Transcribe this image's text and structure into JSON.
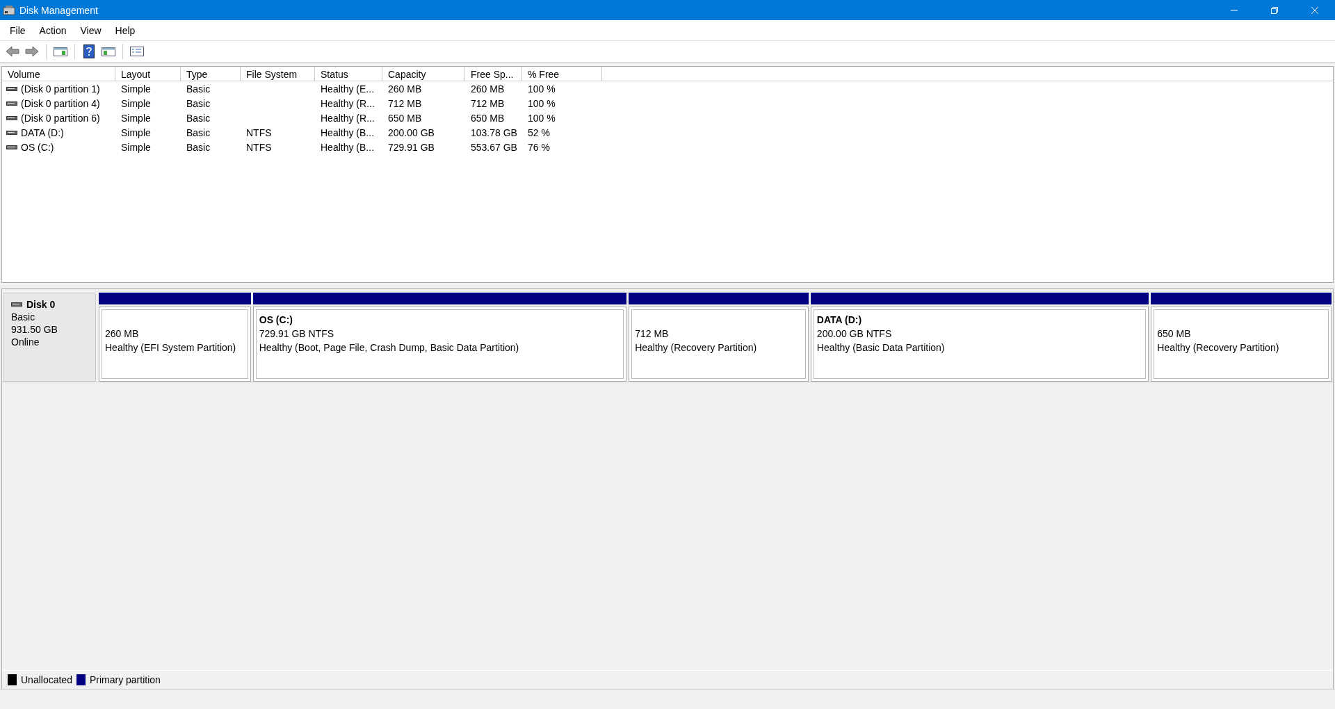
{
  "window": {
    "title": "Disk Management"
  },
  "menu": [
    "File",
    "Action",
    "View",
    "Help"
  ],
  "table": {
    "columns": [
      "Volume",
      "Layout",
      "Type",
      "File System",
      "Status",
      "Capacity",
      "Free Sp...",
      "% Free"
    ],
    "rows": [
      [
        "(Disk 0 partition 1)",
        "Simple",
        "Basic",
        "",
        "Healthy (E...",
        "260 MB",
        "260 MB",
        "100 %"
      ],
      [
        "(Disk 0 partition 4)",
        "Simple",
        "Basic",
        "",
        "Healthy (R...",
        "712 MB",
        "712 MB",
        "100 %"
      ],
      [
        "(Disk 0 partition 6)",
        "Simple",
        "Basic",
        "",
        "Healthy (R...",
        "650 MB",
        "650 MB",
        "100 %"
      ],
      [
        "DATA (D:)",
        "Simple",
        "Basic",
        "NTFS",
        "Healthy (B...",
        "200.00 GB",
        "103.78 GB",
        "52 %"
      ],
      [
        "OS (C:)",
        "Simple",
        "Basic",
        "NTFS",
        "Healthy (B...",
        "729.91 GB",
        "553.67 GB",
        "76 %"
      ]
    ]
  },
  "disk": {
    "name": "Disk 0",
    "type": "Basic",
    "size": "931.50 GB",
    "state": "Online",
    "partitions": [
      {
        "size": "260 MB",
        "status": "Healthy (EFI System Partition)"
      },
      {
        "label": "OS  (C:)",
        "size": "729.91 GB NTFS",
        "status": "Healthy (Boot, Page File, Crash Dump, Basic Data Partition)"
      },
      {
        "size": "712 MB",
        "status": "Healthy (Recovery Partition)"
      },
      {
        "label": "DATA  (D:)",
        "size": "200.00 GB NTFS",
        "status": "Healthy (Basic Data Partition)"
      },
      {
        "size": "650 MB",
        "status": "Healthy (Recovery Partition)"
      }
    ]
  },
  "legend": [
    {
      "label": "Unallocated",
      "color": "#000000"
    },
    {
      "label": "Primary partition",
      "color": "#000080"
    }
  ]
}
